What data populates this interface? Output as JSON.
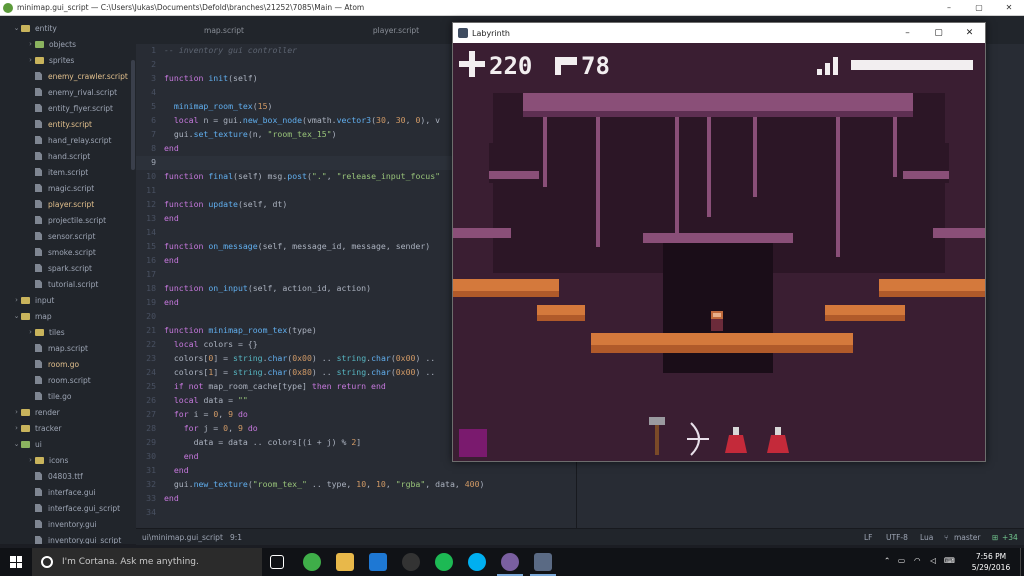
{
  "window": {
    "title": "minimap.gui_script — C:\\Users\\Jukas\\Documents\\Defold\\branches\\21252\\7085\\Main — Atom",
    "controls": [
      "–",
      "▢",
      "✕"
    ]
  },
  "tree": [
    {
      "label": "entity",
      "kind": "folder",
      "open": true,
      "depth": 0
    },
    {
      "label": "objects",
      "kind": "folder-g",
      "open": false,
      "depth": 1
    },
    {
      "label": "sprites",
      "kind": "folder",
      "open": false,
      "depth": 1
    },
    {
      "label": "enemy_crawler.script",
      "kind": "file",
      "depth": 1,
      "mod": true
    },
    {
      "label": "enemy_rival.script",
      "kind": "file",
      "depth": 1
    },
    {
      "label": "entity_flyer.script",
      "kind": "file",
      "depth": 1
    },
    {
      "label": "entity.script",
      "kind": "file",
      "depth": 1,
      "mod": true
    },
    {
      "label": "hand_relay.script",
      "kind": "file",
      "depth": 1
    },
    {
      "label": "hand.script",
      "kind": "file",
      "depth": 1
    },
    {
      "label": "item.script",
      "kind": "file",
      "depth": 1
    },
    {
      "label": "magic.script",
      "kind": "file",
      "depth": 1
    },
    {
      "label": "player.script",
      "kind": "file",
      "depth": 1,
      "mod": true
    },
    {
      "label": "projectile.script",
      "kind": "file",
      "depth": 1
    },
    {
      "label": "sensor.script",
      "kind": "file",
      "depth": 1
    },
    {
      "label": "smoke.script",
      "kind": "file",
      "depth": 1
    },
    {
      "label": "spark.script",
      "kind": "file",
      "depth": 1
    },
    {
      "label": "tutorial.script",
      "kind": "file",
      "depth": 1
    },
    {
      "label": "input",
      "kind": "folder",
      "open": false,
      "depth": 0
    },
    {
      "label": "map",
      "kind": "folder",
      "open": true,
      "depth": 0
    },
    {
      "label": "tiles",
      "kind": "folder",
      "open": false,
      "depth": 1
    },
    {
      "label": "map.script",
      "kind": "file",
      "depth": 1
    },
    {
      "label": "room.go",
      "kind": "file",
      "depth": 1,
      "mod": true
    },
    {
      "label": "room.script",
      "kind": "file",
      "depth": 1
    },
    {
      "label": "tile.go",
      "kind": "file",
      "depth": 1
    },
    {
      "label": "render",
      "kind": "folder",
      "open": false,
      "depth": 0
    },
    {
      "label": "tracker",
      "kind": "folder",
      "open": false,
      "depth": 0
    },
    {
      "label": "ui",
      "kind": "folder-g",
      "open": true,
      "depth": 0
    },
    {
      "label": "icons",
      "kind": "folder",
      "open": false,
      "depth": 1
    },
    {
      "label": "04803.ttf",
      "kind": "file",
      "depth": 1
    },
    {
      "label": "interface.gui",
      "kind": "file",
      "depth": 1
    },
    {
      "label": "interface.gui_script",
      "kind": "file",
      "depth": 1
    },
    {
      "label": "inventory.gui",
      "kind": "file",
      "depth": 1
    },
    {
      "label": "inventory.gui_script",
      "kind": "file",
      "depth": 1
    }
  ],
  "tabs": [
    "map.script",
    "player.script"
  ],
  "code": [
    {
      "n": "1",
      "html": "<span class='cm'>-- inventory gui controller</span>"
    },
    {
      "n": "2",
      "html": ""
    },
    {
      "n": "3",
      "html": "<span class='kw'>function</span> <span class='fn'>init</span>(self)"
    },
    {
      "n": "4",
      "html": ""
    },
    {
      "n": "5",
      "html": "  <span class='fn'>minimap_room_tex</span>(<span class='num'>15</span>)"
    },
    {
      "n": "6",
      "html": "  <span class='kw'>local</span> n = gui.<span class='fn'>new_box_node</span>(vmath.<span class='fn'>vector3</span>(<span class='num'>30</span>, <span class='num'>30</span>, <span class='num'>0</span>), v"
    },
    {
      "n": "7",
      "html": "  gui.<span class='fn'>set_texture</span>(n, <span class='str'>\"room_tex_15\"</span>)"
    },
    {
      "n": "8",
      "html": "<span class='kw'>end</span>"
    },
    {
      "n": "9",
      "html": "",
      "current": true
    },
    {
      "n": "10",
      "html": "<span class='kw'>function</span> <span class='fn'>final</span>(self) msg.<span class='fn'>post</span>(<span class='str'>\".\"</span>, <span class='str'>\"release_input_focus\"</span>"
    },
    {
      "n": "11",
      "html": ""
    },
    {
      "n": "12",
      "html": "<span class='kw'>function</span> <span class='fn'>update</span>(self, dt)"
    },
    {
      "n": "13",
      "html": "<span class='kw'>end</span>"
    },
    {
      "n": "14",
      "html": ""
    },
    {
      "n": "15",
      "html": "<span class='kw'>function</span> <span class='fn'>on_message</span>(self, message_id, message, sender)"
    },
    {
      "n": "16",
      "html": "<span class='kw'>end</span>"
    },
    {
      "n": "17",
      "html": ""
    },
    {
      "n": "18",
      "html": "<span class='kw'>function</span> <span class='fn'>on_input</span>(self, action_id, action)"
    },
    {
      "n": "19",
      "html": "<span class='kw'>end</span>"
    },
    {
      "n": "20",
      "html": ""
    },
    {
      "n": "21",
      "html": "<span class='kw'>function</span> <span class='fn'>minimap_room_tex</span>(type)"
    },
    {
      "n": "22",
      "html": "  <span class='kw'>local</span> colors = {}"
    },
    {
      "n": "23",
      "html": "  colors[<span class='num'>0</span>] = <span class='bi'>string</span>.<span class='fn'>char</span>(<span class='num'>0x00</span>) .. <span class='bi'>string</span>.<span class='fn'>char</span>(<span class='num'>0x00</span>) .."
    },
    {
      "n": "24",
      "html": "  colors[<span class='num'>1</span>] = <span class='bi'>string</span>.<span class='fn'>char</span>(<span class='num'>0x80</span>) .. <span class='bi'>string</span>.<span class='fn'>char</span>(<span class='num'>0x00</span>) .."
    },
    {
      "n": "25",
      "html": "  <span class='kw'>if not</span> map_room_cache[type] <span class='kw'>then return end</span>"
    },
    {
      "n": "26",
      "html": "  <span class='kw'>local</span> data = <span class='str'>\"\"</span>"
    },
    {
      "n": "27",
      "html": "  <span class='kw'>for</span> i = <span class='num'>0</span>, <span class='num'>9</span> <span class='kw'>do</span>"
    },
    {
      "n": "28",
      "html": "    <span class='kw'>for</span> j = <span class='num'>0</span>, <span class='num'>9</span> <span class='kw'>do</span>"
    },
    {
      "n": "29",
      "html": "      data = data .. colors[(i + j) % <span class='num'>2</span>]"
    },
    {
      "n": "30",
      "html": "    <span class='kw'>end</span>"
    },
    {
      "n": "31",
      "html": "  <span class='kw'>end</span>"
    },
    {
      "n": "32",
      "html": "  gui.<span class='fn'>new_texture</span>(<span class='str'>\"room_tex_\"</span> .. type, <span class='num'>10</span>, <span class='num'>10</span>, <span class='str'>\"rgba\"</span>, data, <span class='num'>400</span>)"
    },
    {
      "n": "33",
      "html": "<span class='kw'>end</span>"
    },
    {
      "n": "34",
      "html": ""
    }
  ],
  "status": {
    "file": "ui\\minimap.gui_script",
    "cursor": "9:1",
    "line_ending": "LF",
    "encoding": "UTF-8",
    "grammar": "Lua",
    "branch": "master",
    "diff": "+34"
  },
  "game": {
    "window_title": "Labyrinth",
    "controls": [
      "–",
      "▢",
      "✕"
    ],
    "health": "220",
    "ammo": "78"
  },
  "taskbar": {
    "cortana_placeholder": "I'm Cortana. Ask me anything.",
    "time": "7:56 PM",
    "date": "5/29/2016"
  }
}
